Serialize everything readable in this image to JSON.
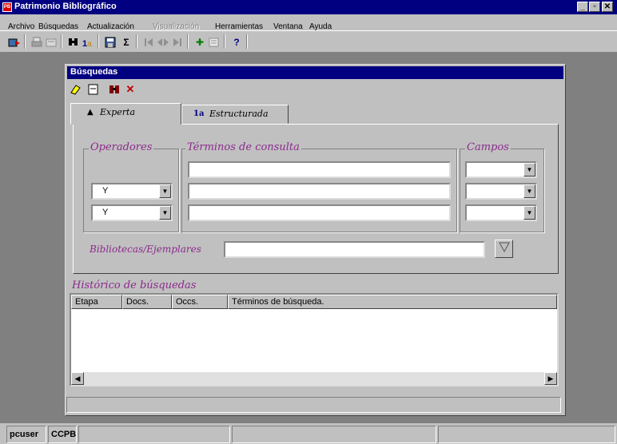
{
  "app": {
    "title": "Patrimonio Bibliográfico",
    "icon_text": "PB"
  },
  "window_buttons": {
    "minimize": "_",
    "restore": "▫",
    "close": "✕"
  },
  "menu": [
    "Archivo",
    "Búsquedas",
    "Actualización",
    "Visualización",
    "Herramientas",
    "Ventana",
    "Ayuda"
  ],
  "toolbar": {
    "icons": [
      "exit-icon",
      "print-icon",
      "open-icon",
      "search-icon",
      "structured-search-icon",
      "save-icon",
      "sum-icon",
      "first-record-icon",
      "navigate-icon",
      "last-record-icon",
      "add-icon",
      "edit-icon",
      "help-icon"
    ],
    "glyphs": {
      "sum": "Σ",
      "add": "✚",
      "help": "?"
    }
  },
  "search_window": {
    "title": "Búsquedas",
    "toolbar_icons": [
      "eraser-icon",
      "clear-form-icon",
      "binoculars-icon",
      "delete-icon"
    ],
    "delete_glyph": "✕",
    "tabs": [
      {
        "label": "Experta",
        "active": true
      },
      {
        "label": "Estructurada",
        "active": false
      }
    ],
    "tab_icons": {
      "binoculars": "▲",
      "structured": "1a"
    },
    "operators": {
      "legend": "Operadores",
      "rows": [
        "Y",
        "Y"
      ]
    },
    "terms": {
      "legend": "Términos de consulta",
      "values": [
        "",
        "",
        ""
      ]
    },
    "fields": {
      "legend": "Campos",
      "values": [
        "",
        "",
        ""
      ]
    },
    "libraries": {
      "label": "Bibliotecas/Ejemplares",
      "value": ""
    },
    "history": {
      "title": "Histórico de búsquedas",
      "columns": [
        "Etapa",
        "Docs.",
        "Occs.",
        "Términos de búsqueda."
      ],
      "rows": []
    },
    "scroll_arrows": {
      "left": "◀",
      "right": "▶"
    }
  },
  "statusbar": {
    "user": "pcuser",
    "org": "CCPB",
    "panels": [
      "",
      "",
      ""
    ]
  }
}
